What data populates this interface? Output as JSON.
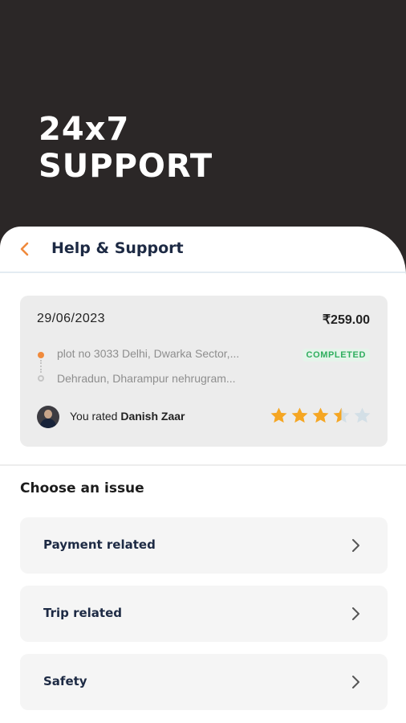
{
  "hero": {
    "line1": "24x7",
    "line2": "SUPPORT"
  },
  "header": {
    "back_icon": "chevron-left-icon",
    "title": "Help & Support"
  },
  "colors": {
    "accent": "#f08a3c",
    "star": "#f5a623",
    "status": "#2fae5e",
    "title": "#1d2a44"
  },
  "ride": {
    "date": "29/06/2023",
    "price": "₹259.00",
    "pickup": "plot no 3033 Delhi, Dwarka Sector,...",
    "drop": "Dehradun, Dharampur nehrugram...",
    "status": "COMPLETED",
    "rated_prefix": "You rated",
    "driver_name": "Danish Zaar",
    "rating": 3.5,
    "rating_max": 5
  },
  "issues": {
    "heading": "Choose an issue",
    "items": [
      {
        "label": "Payment related"
      },
      {
        "label": "Trip related"
      },
      {
        "label": "Safety"
      }
    ]
  }
}
